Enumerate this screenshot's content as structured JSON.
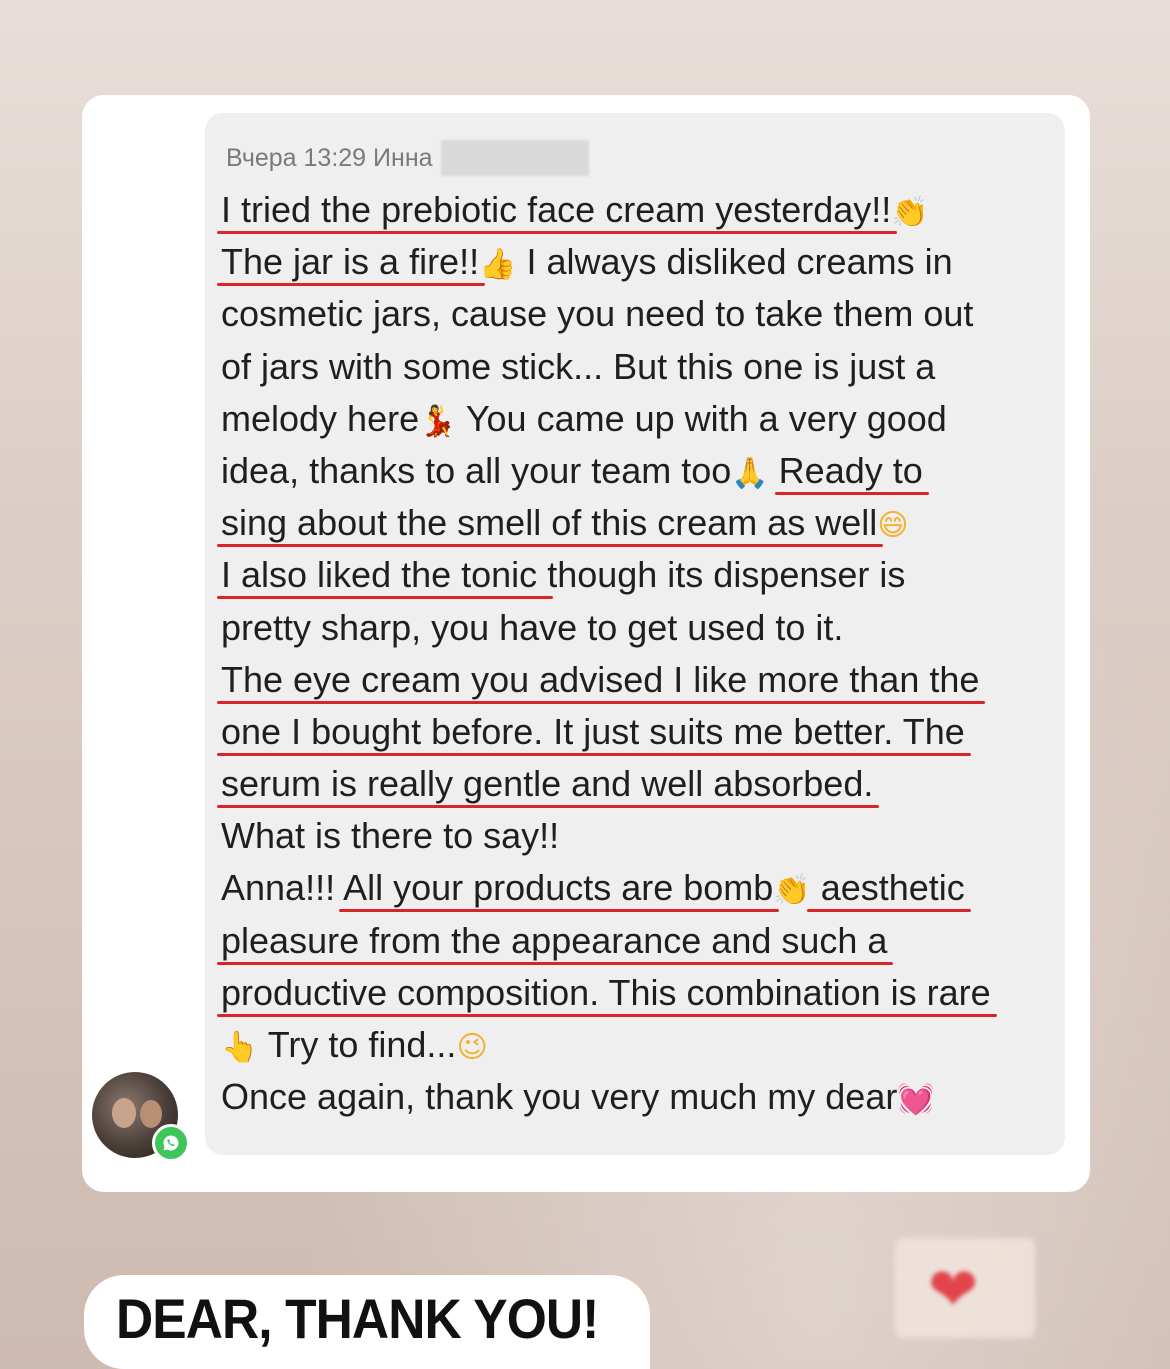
{
  "meta": {
    "date": "Вчера 13:29",
    "sender": "Инна"
  },
  "message": {
    "lines": [
      [
        {
          "t": "I tried the prebiotic face cream yesterday!!",
          "u": true
        },
        {
          "e": "👏",
          "c": ""
        }
      ],
      [
        {
          "t": "The jar is a fire!!",
          "u": true
        },
        {
          "e": "👍",
          "c": ""
        },
        {
          "t": " I always disliked creams in",
          "u": false
        }
      ],
      [
        {
          "t": "cosmetic jars, cause you need to take them out",
          "u": false
        }
      ],
      [
        {
          "t": "of jars with some stick... But this one is just a",
          "u": false
        }
      ],
      [
        {
          "t": "melody here",
          "u": false
        },
        {
          "e": "💃",
          "c": "em-red"
        },
        {
          "t": " You came up with a very good",
          "u": false
        }
      ],
      [
        {
          "t": "idea, thanks to all your team too",
          "u": false
        },
        {
          "e": "🙏",
          "c": ""
        },
        {
          "t": " ",
          "u": false
        },
        {
          "t": "Ready to",
          "u": true
        }
      ],
      [
        {
          "t": "sing about the smell of this cream as well",
          "u": true
        },
        {
          "e": "😄",
          "c": ""
        }
      ],
      [
        {
          "t": "I also liked the tonic ",
          "u": true
        },
        {
          "t": "though its dispenser is",
          "u": false
        }
      ],
      [
        {
          "t": "pretty sharp, you have to get used to it.",
          "u": false
        }
      ],
      [
        {
          "t": "The eye cream you advised I like more than the",
          "u": true
        }
      ],
      [
        {
          "t": "one I bought before. It just suits me better. The",
          "u": true
        }
      ],
      [
        {
          "t": "serum is really gentle and well absorbed.",
          "u": true
        }
      ],
      [
        {
          "t": "What is there to say!!",
          "u": false
        }
      ],
      [
        {
          "t": "Anna!!! ",
          "u": false
        },
        {
          "t": "All your products are bomb",
          "u": true
        },
        {
          "e": "👏",
          "c": ""
        },
        {
          "t": " aesthetic",
          "u": true
        }
      ],
      [
        {
          "t": "pleasure from the appearance and such a",
          "u": true
        }
      ],
      [
        {
          "t": "productive composition. This combination is rare",
          "u": true
        }
      ],
      [
        {
          "e": "👆",
          "c": "em-skin"
        },
        {
          "t": " Try to find...",
          "u": false
        },
        {
          "e": "😉",
          "c": ""
        }
      ],
      [
        {
          "t": "Once again, thank you very much my dear",
          "u": false
        },
        {
          "e": "💓",
          "c": "em-pink"
        }
      ]
    ]
  },
  "caption": {
    "text": "DEAR, THANK YOU!"
  },
  "icons": {
    "avatar": "contact-avatar",
    "badge": "whatsapp-icon",
    "sticker": "heart-icon"
  },
  "colors": {
    "underline": "#d7262a",
    "bubble": "#efefef",
    "whatsapp": "#3ec65a"
  }
}
